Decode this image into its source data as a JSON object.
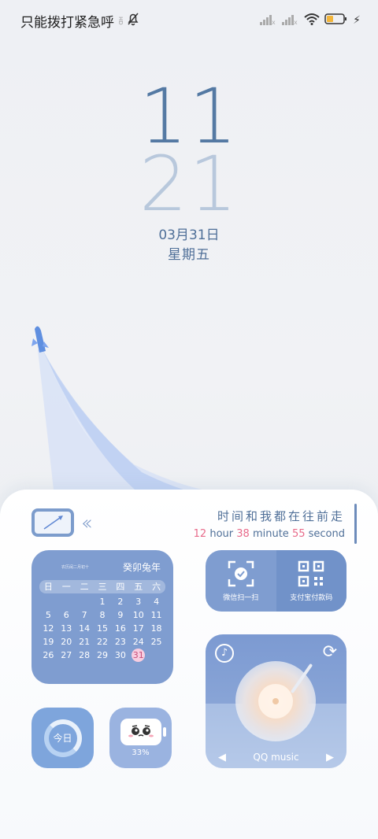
{
  "status_bar": {
    "carrier": "只能拨打紧急呼",
    "hd": "HD",
    "battery_flash": "⚡"
  },
  "clock": {
    "hour": "11",
    "minute": "21",
    "date": "03月31日",
    "weekday": "星期五"
  },
  "motto": {
    "text": "时间和我都在往前走"
  },
  "timeline": {
    "hours": "12",
    "hour_label": "hour",
    "minutes": "38",
    "minute_label": "minute",
    "seconds": "55",
    "second_label": "second"
  },
  "calendar": {
    "lunar": "农历闰二月初十",
    "year": "癸卯兔年",
    "weekdays": [
      "日",
      "一",
      "二",
      "三",
      "四",
      "五",
      "六"
    ],
    "days": [
      "",
      "",
      "",
      "",
      "",
      "",
      "",
      "",
      "",
      "",
      "",
      "1",
      "2",
      "3",
      "4"
    ],
    "rows": [
      [
        "",
        "",
        "",
        "",
        "",
        "1",
        "2"
      ],
      [
        "",
        "",
        "",
        "",
        "",
        "",
        ""
      ]
    ],
    "today": "31"
  },
  "pay": {
    "wechat": "微信扫一扫",
    "alipay": "支付宝付款码"
  },
  "today_widget": {
    "label": "今日"
  },
  "battery_widget": {
    "percent": "33%"
  },
  "music": {
    "label": "QQ music"
  }
}
